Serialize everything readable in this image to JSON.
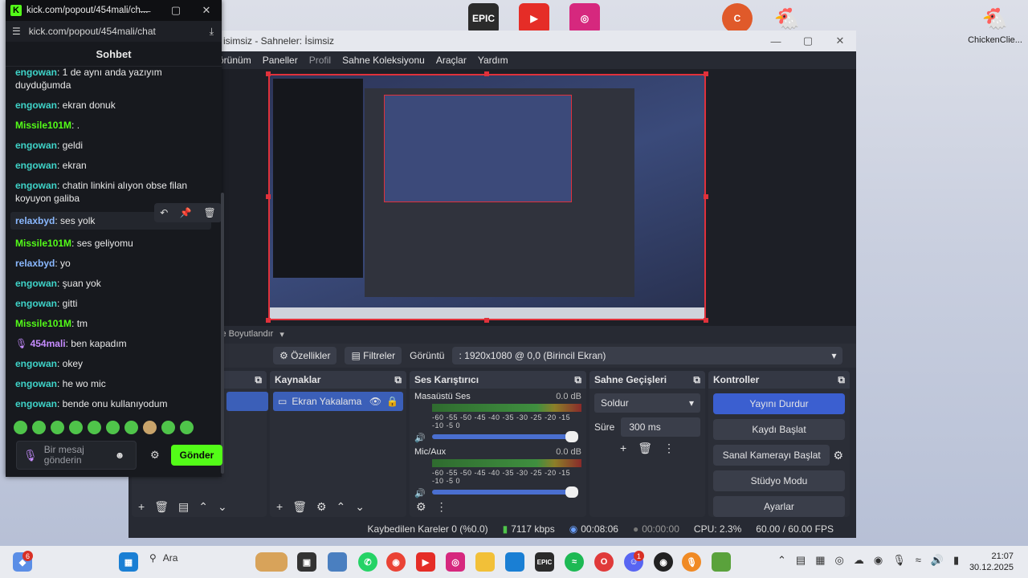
{
  "desktop": {
    "icons": [
      {
        "label": "",
        "glyph": "EPIC",
        "color": "#2b2b2b"
      },
      {
        "label": "",
        "glyph": "▶",
        "color": "#e52d27"
      },
      {
        "label": "",
        "glyph": "◎",
        "color": "#d6287e"
      },
      {
        "label": "",
        "glyph": "C",
        "color": "#e05a2a"
      },
      {
        "label": "",
        "glyph": "🐔",
        "color": "#c93b2b"
      },
      {
        "label": "ChickenClie...",
        "glyph": "🐔",
        "color": "#c93b2b"
      }
    ]
  },
  "kick": {
    "window_title": "kick.com/popout/454mali/ch...",
    "url": "kick.com/popout/454mali/chat",
    "header": "Sohbet",
    "messages": [
      {
        "user": "engowan",
        "text": ": 1 de aynı anda yazıyım duyduğumda",
        "color": "teal"
      },
      {
        "user": "engowan",
        "text": ": ekran donuk",
        "color": "teal"
      },
      {
        "user": "Missile101M",
        "text": ": .",
        "color": "green"
      },
      {
        "user": "engowan",
        "text": ": geldi",
        "color": "teal"
      },
      {
        "user": "engowan",
        "text": ": ekran",
        "color": "teal"
      },
      {
        "user": "engowan",
        "text": ": chatin linkini alıyon obse filan koyuyon galiba",
        "color": "teal"
      },
      {
        "user": "relaxbyd",
        "text": ": ses yolk",
        "color": "blue",
        "highlight": true
      },
      {
        "user": "Missile101M",
        "text": ": ses geliyomu",
        "color": "green"
      },
      {
        "user": "relaxbyd",
        "text": ": yo",
        "color": "blue"
      },
      {
        "user": "engowan",
        "text": ": şuan yok",
        "color": "teal"
      },
      {
        "user": "engowan",
        "text": ": gitti",
        "color": "teal"
      },
      {
        "user": "Missile101M",
        "text": ": tm",
        "color": "green"
      },
      {
        "user": "454mali",
        "text": ": ben kapadım",
        "color": "purple",
        "mic": true
      },
      {
        "user": "engowan",
        "text": ": okey",
        "color": "teal"
      },
      {
        "user": "engowan",
        "text": ": he wo mic",
        "color": "teal"
      },
      {
        "user": "engowan",
        "text": ": bende onu kullanıyodum",
        "color": "teal"
      }
    ],
    "input_placeholder": "Bir mesaj gönderin",
    "send_label": "Gönder",
    "accent": "#53fc18"
  },
  "obs": {
    "title": "isimsiz - Sahneler: İsimsiz",
    "menu": [
      "örünüm",
      "Paneller",
      "Profil",
      "Sahne Koleksiyonu",
      "Araçlar",
      "Yardım"
    ],
    "scale_label": "ve Boyutlandır",
    "toolbar": {
      "properties": "Özellikler",
      "filters": "Filtreler",
      "display_label": "Görüntü",
      "display_value": ": 1920x1080 @ 0,0 (Birincil Ekran)"
    },
    "sources": {
      "title": "Kaynaklar",
      "item": "Ekran Yakalama"
    },
    "mixer": {
      "title": "Ses Karıştırıcı",
      "channels": [
        {
          "name": "Masaüstü Ses",
          "db": "0.0 dB"
        },
        {
          "name": "Mic/Aux",
          "db": "0.0 dB"
        }
      ],
      "scale": "-60 -55 -50 -45 -40 -35 -30 -25 -20 -15 -10 -5 0"
    },
    "transitions": {
      "title": "Sahne Geçişleri",
      "type": "Soldur",
      "duration_label": "Süre",
      "duration": "300 ms"
    },
    "controls": {
      "title": "Kontroller",
      "buttons": [
        "Yayını Durdur",
        "Kaydı Başlat",
        "Sanal Kamerayı Başlat",
        "Stüdyo Modu",
        "Ayarlar"
      ]
    },
    "status": {
      "dropped": "Kaybedilen Kareler 0 (%0.0)",
      "bitrate": "7117 kbps",
      "stream_time": "00:08:06",
      "rec_time": "00:00:00",
      "cpu": "CPU: 2.3%",
      "fps": "60.00 / 60.00 FPS"
    }
  },
  "taskbar": {
    "search": "Ara",
    "time": "21:07",
    "date": "30.12.2025",
    "widget_badge": "6",
    "discord_badge": "1"
  }
}
